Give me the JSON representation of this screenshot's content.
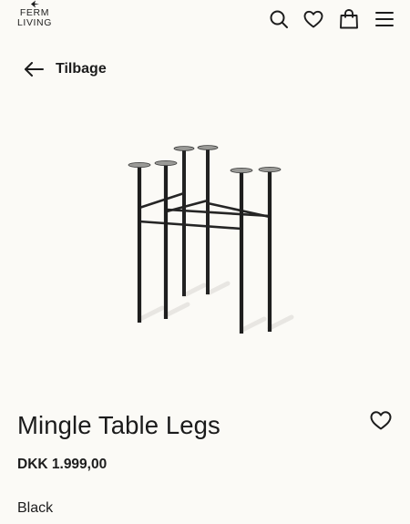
{
  "header": {
    "logo_line1": "FERM",
    "logo_line2": "LIVING",
    "icons": [
      "search-icon",
      "heart-icon",
      "shopping-bag-icon",
      "menu-icon"
    ]
  },
  "nav": {
    "back_label": "Tilbage",
    "back_icon": "arrow-left-icon"
  },
  "product": {
    "title": "Mingle Table Legs",
    "price": "DKK 1.999,00",
    "color": "Black",
    "wishlist_icon": "heart-outline-icon",
    "image": "table-legs-image"
  },
  "colors": {
    "background": "#fbfaf6",
    "text": "#1c1c1c",
    "product_metal": "#1f1f1f"
  }
}
